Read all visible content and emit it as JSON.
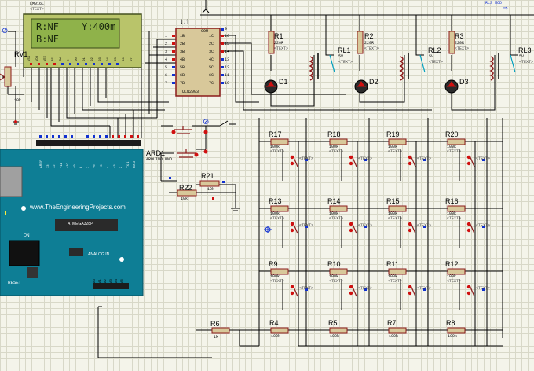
{
  "lcd": {
    "part_label": "LM016L",
    "line1_left": "R:NF",
    "line1_right": "Y:400m",
    "line2": "B:NF",
    "text_placeholder": "<TEXT>",
    "pin_labels": [
      "VSS",
      "VDD",
      "VEE",
      "RS",
      "RW",
      "E",
      "D0",
      "D1",
      "D2",
      "D3",
      "D4",
      "D5",
      "D6",
      "D7"
    ]
  },
  "rv1": {
    "label": "RV1",
    "value": "10k"
  },
  "u1": {
    "label": "U1",
    "part": "ULN2003",
    "com": "COM",
    "left_pins": [
      "1B",
      "2B",
      "3B",
      "4B",
      "5B",
      "6B",
      "7B"
    ],
    "left_nums": [
      "1",
      "2",
      "3",
      "4",
      "5",
      "6",
      "7"
    ],
    "right_pins": [
      "1C",
      "2C",
      "3C",
      "4C",
      "5C",
      "6C",
      "7C"
    ],
    "right_nums": [
      "16",
      "15",
      "14",
      "13",
      "12",
      "11",
      "10"
    ],
    "pin9": "9"
  },
  "relays": [
    {
      "resistor": "R1",
      "r_value": "220R",
      "diode": "D1",
      "relay": "RL1",
      "volt": "5V"
    },
    {
      "resistor": "R2",
      "r_value": "220R",
      "diode": "D2",
      "relay": "RL2",
      "volt": "5V"
    },
    {
      "resistor": "R3",
      "r_value": "220R",
      "diode": "D3",
      "relay": "RL3",
      "volt": "5V"
    }
  ],
  "arduino": {
    "label": "ARD1",
    "subtitle": "ARDUINO UNO",
    "watermark": "www.TheEngineeringProjects.com",
    "chip": "ATMEGA328P",
    "analog_in": "ANALOG IN",
    "on": "ON",
    "reset": "RESET",
    "dig_pins": [
      "AREF",
      "13",
      "12",
      "~11",
      "~10",
      "~9",
      "8",
      "7",
      "~6",
      "~5",
      "4",
      "~3",
      "2",
      "TX 1",
      "RX 0"
    ],
    "ana_pins": [
      "A0",
      "A1",
      "A2",
      "A3",
      "A4",
      "A5"
    ]
  },
  "resistors_misc": [
    {
      "name": "R21",
      "value": "10k"
    },
    {
      "name": "R22",
      "value": "10k"
    },
    {
      "name": "R6",
      "value": "1k"
    }
  ],
  "grid_rows": [
    [
      "R17",
      "R18",
      "R19",
      "R20"
    ],
    [
      "R13",
      "R14",
      "R15",
      "R16"
    ],
    [
      "R9",
      "R10",
      "R11",
      "R12"
    ]
  ],
  "bottom_row": [
    "R4",
    "R5",
    "R7",
    "R8"
  ],
  "grid_value": "100k",
  "text_tag": "<TEXT>",
  "top_labels": {
    "lcd_tag": "LM016L",
    "right_tag": "RL3 MOD"
  },
  "colors": {
    "wire": "#000000",
    "component": "#8b1a1a",
    "component_fill": "#d8c89a",
    "lcd_bezel": "#b9c46a",
    "lcd_screen": "#8fb24a",
    "arduino": "#0e7e95",
    "pin_red": "#d01010",
    "pin_blue": "#1030d0",
    "chip": "#2a2a2a"
  }
}
